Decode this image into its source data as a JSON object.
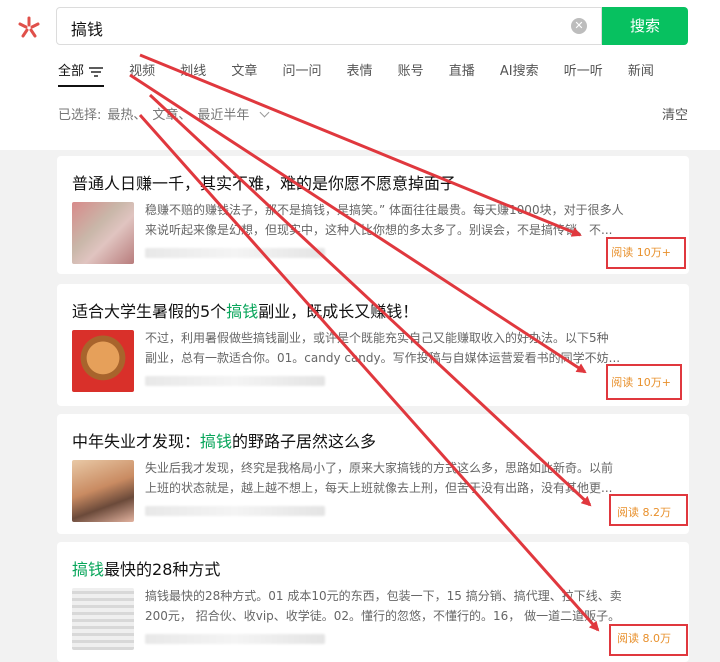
{
  "search": {
    "query": "搞钱",
    "button_label": "搜索"
  },
  "tabs": [
    "全部",
    "视频",
    "划线",
    "文章",
    "问一问",
    "表情",
    "账号",
    "直播",
    "AI搜索",
    "听一听",
    "新闻"
  ],
  "filter": {
    "prefix": "已选择:",
    "items": [
      "最热、",
      "文章、",
      "最近半年"
    ],
    "clear_label": "清空"
  },
  "results": [
    {
      "title_pre": "普通人日赚一千，其实不难，难的是你愿不愿意掉面子",
      "title_hl": "",
      "title_post": "",
      "snippet_line1": "稳赚不赔的赚钱法子，那不是搞钱，是搞笑。” 体面往往最贵。每天赚1000块，对于很多人",
      "snippet_line2": "来说听起来像是幻想，但现实中，这种人比你想的多太多了。别误会，不是搞传销、不...",
      "read": "阅读 10万+"
    },
    {
      "title_pre": "适合大学生暑假的5个",
      "title_hl": "搞钱",
      "title_post": "副业，既成长又赚钱！",
      "snippet_line1": "不过，利用暑假做些搞钱副业，或许是个既能充实自己又能赚取收入的好办法。以下5种",
      "snippet_line2": "副业，总有一款适合你。01。candy candy。写作投稿与自媒体运营爱看书的同学不妨...",
      "read": "阅读 10万+"
    },
    {
      "title_pre": "中年失业才发现：",
      "title_hl": "搞钱",
      "title_post": "的野路子居然这么多",
      "snippet_line1": "失业后我才发现，终究是我格局小了，原来大家搞钱的方式这么多，思路如此新奇。以前",
      "snippet_line2": "上班的状态就是，越上越不想上，每天上班就像去上刑，但苦于没有出路，没有其他更...",
      "read": "阅读 8.2万"
    },
    {
      "title_pre": "",
      "title_hl": "搞钱",
      "title_post": "最快的28种方式",
      "snippet_line1": "搞钱最快的28种方式。01 成本10元的东西，包装一下，15 搞分销、搞代理、拉下线、卖",
      "snippet_line2": "200元， 招合伙、收vip、收学徒。02。懂行的忽悠，不懂行的。16， 做一道二道贩子。",
      "read": "阅读 8.0万"
    }
  ],
  "colors": {
    "accent": "#07c160",
    "highlight": "#07a55a",
    "read": "#e8902c",
    "annotation": "#e0383e"
  }
}
